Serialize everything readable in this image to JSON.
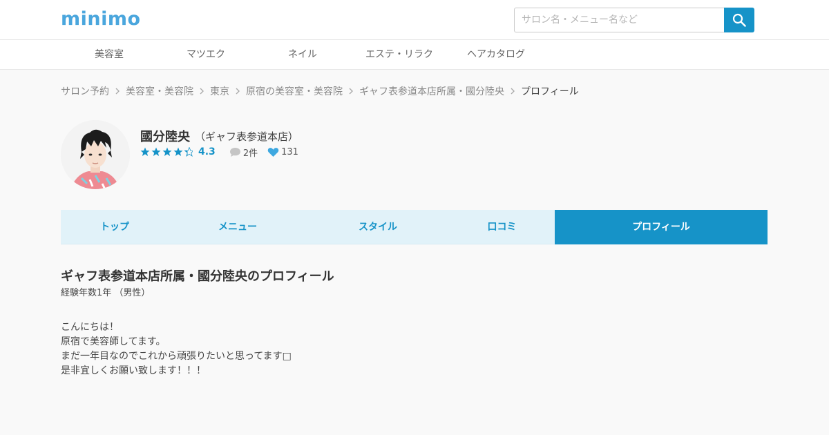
{
  "header": {
    "logo": "minimo",
    "search": {
      "placeholder": "サロン名・メニュー名など",
      "value": ""
    }
  },
  "nav": {
    "items": [
      {
        "label": "美容室"
      },
      {
        "label": "マツエク"
      },
      {
        "label": "ネイル"
      },
      {
        "label": "エステ・リラク"
      },
      {
        "label": "ヘアカタログ"
      }
    ]
  },
  "breadcrumb": {
    "items": [
      {
        "label": "サロン予約"
      },
      {
        "label": "美容室・美容院"
      },
      {
        "label": "東京"
      },
      {
        "label": "原宿の美容室・美容院"
      },
      {
        "label": "ギャフ表参道本店所属・國分陸央"
      },
      {
        "label": "プロフィール"
      }
    ]
  },
  "stylist": {
    "name": "國分陸央",
    "salon": "（ギャフ表参道本店）",
    "rating": "4.3",
    "rating_value": 4.3,
    "reviews": "2件",
    "likes": "131"
  },
  "tabs": {
    "items": [
      {
        "label": "トップ"
      },
      {
        "label": "メニュー"
      },
      {
        "label": "スタイル"
      },
      {
        "label": "口コミ"
      },
      {
        "label": "プロフィール"
      }
    ],
    "active": 4
  },
  "profile": {
    "title": "ギャフ表参道本店所属・國分陸央のプロフィール",
    "experience": "経験年数1年 （男性）",
    "bio_lines": [
      "こんにちは！",
      "原宿で美容師してます。",
      "まだ一年目なのでこれから頑張りたいと思ってます□",
      "是非宜しくお願い致します！！！"
    ]
  },
  "colors": {
    "accent": "#1693c8",
    "logo": "#4aa6dd",
    "tab_background": "#e1f2f9",
    "like": "#3ea8e0"
  }
}
